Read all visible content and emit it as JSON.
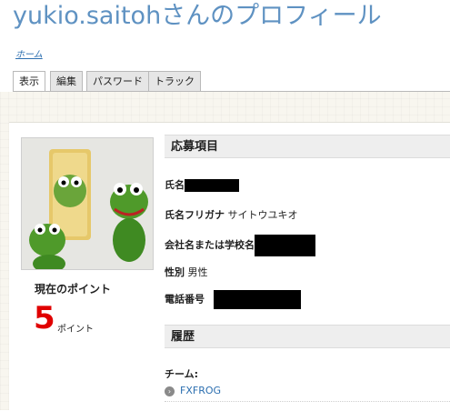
{
  "header": {
    "title": "yukio.saitohさんのプロフィール",
    "breadcrumb": "ホーム"
  },
  "tabs": [
    {
      "label": "表示",
      "active": true
    },
    {
      "label": "編集",
      "active": false
    },
    {
      "label": "パスワード",
      "active": false
    },
    {
      "label": "トラック",
      "active": false
    }
  ],
  "sidebar": {
    "points_label": "現在のポイント",
    "points_value": "5",
    "points_unit": "ポイント"
  },
  "application": {
    "header": "応募項目",
    "name_label": "氏名",
    "furigana_label": "氏名フリガナ",
    "furigana_value": "サイトウユキオ",
    "company_label": "会社名または学校名",
    "gender_label": "性別",
    "gender_value": "男性",
    "phone_label": "電話番号"
  },
  "history": {
    "header": "履歴",
    "team_label": "チーム:",
    "team_link": "FXFROG"
  },
  "colors": {
    "title": "#5f92c2",
    "link": "#2c6fb0",
    "points": "#e00000"
  }
}
